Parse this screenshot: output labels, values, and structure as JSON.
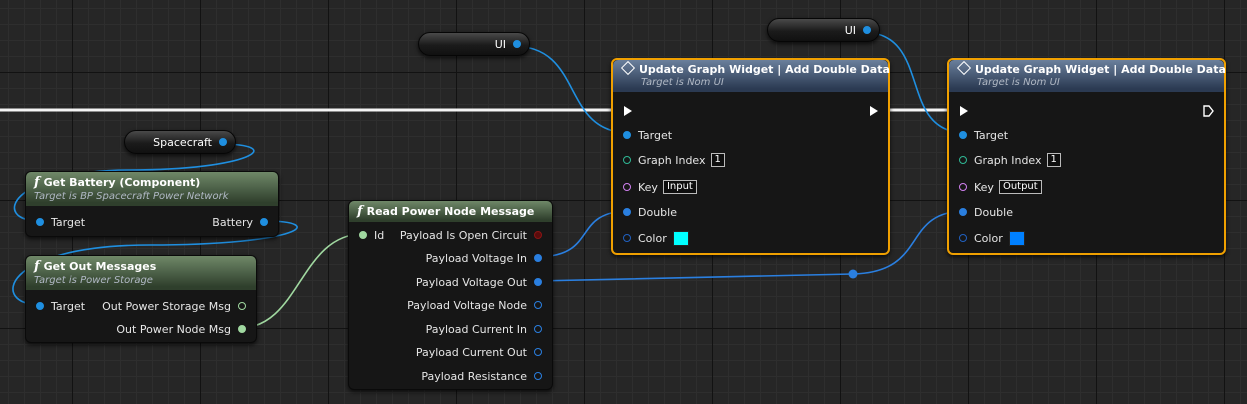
{
  "colors": {
    "object_pin": "#1f8fe0",
    "struct_pin": "#a0d8a0",
    "double_pin": "#2a7fe0",
    "int_pin": "#2fb895",
    "string_pin": "#d080f0",
    "color_pin": "#2060c0",
    "bool_pin": "#8b1414",
    "exec_wire": "#ffffff",
    "selection": "#f0a000"
  },
  "variables": {
    "ui_1": "UI",
    "ui_2": "UI",
    "spacecraft": "Spacecraft"
  },
  "get_battery": {
    "title": "Get Battery (Component)",
    "subtitle": "Target is BP Spacecraft Power Network",
    "target": "Target",
    "battery": "Battery",
    "icon": "function-icon"
  },
  "get_out_messages": {
    "title": "Get Out Messages",
    "subtitle": "Target is Power Storage",
    "target": "Target",
    "out_storage": "Out Power Storage Msg",
    "out_node": "Out Power Node Msg",
    "icon": "function-icon"
  },
  "read_power": {
    "title": "Read Power Node Message",
    "id": "Id",
    "outputs": [
      "Payload Is Open Circuit",
      "Payload Voltage In",
      "Payload Voltage Out",
      "Payload Voltage Node",
      "Payload Current In",
      "Payload Current Out",
      "Payload Resistance"
    ],
    "icon": "function-icon"
  },
  "update_1": {
    "title": "Update Graph Widget  |  Add Double Data",
    "subtitle": "Target is Nom UI",
    "target": "Target",
    "graph_index_label": "Graph Index",
    "graph_index_value": "1",
    "key_label": "Key",
    "key_value": "Input",
    "double_label": "Double",
    "color_label": "Color",
    "color_value": "#00ffff",
    "icon": "diamond-icon"
  },
  "update_2": {
    "title": "Update Graph Widget  |  Add Double Data",
    "subtitle": "Target is Nom UI",
    "target": "Target",
    "graph_index_label": "Graph Index",
    "graph_index_value": "1",
    "key_label": "Key",
    "key_value": "Output",
    "double_label": "Double",
    "color_label": "Color",
    "color_value": "#0080ff",
    "icon": "diamond-icon"
  }
}
